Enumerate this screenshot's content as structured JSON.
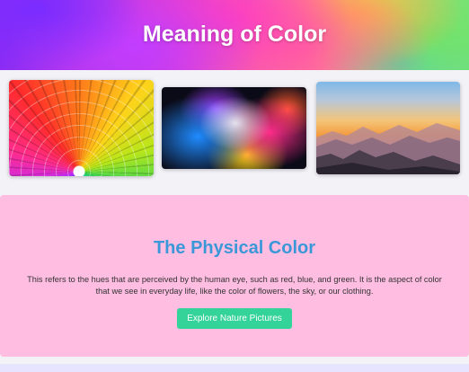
{
  "header": {
    "title": "Meaning of Color"
  },
  "gallery": {
    "images": [
      {
        "name": "color-wheel-image"
      },
      {
        "name": "color-powder-explosion-image"
      },
      {
        "name": "mountain-sunset-image"
      }
    ]
  },
  "section": {
    "title": "The Physical Color",
    "line1": "This refers to the hues that are perceived by the human eye, such as red, blue, and green. It is the aspect of color",
    "line2": "that we see in everyday life, like the color of flowers, the sky, or our clothing.",
    "button_label": "Explore Nature Pictures"
  },
  "colors": {
    "section_background": "#ffbde1",
    "title_color": "#3a98d8",
    "button_color": "#34d399",
    "page_background": "#f2f2f7"
  }
}
